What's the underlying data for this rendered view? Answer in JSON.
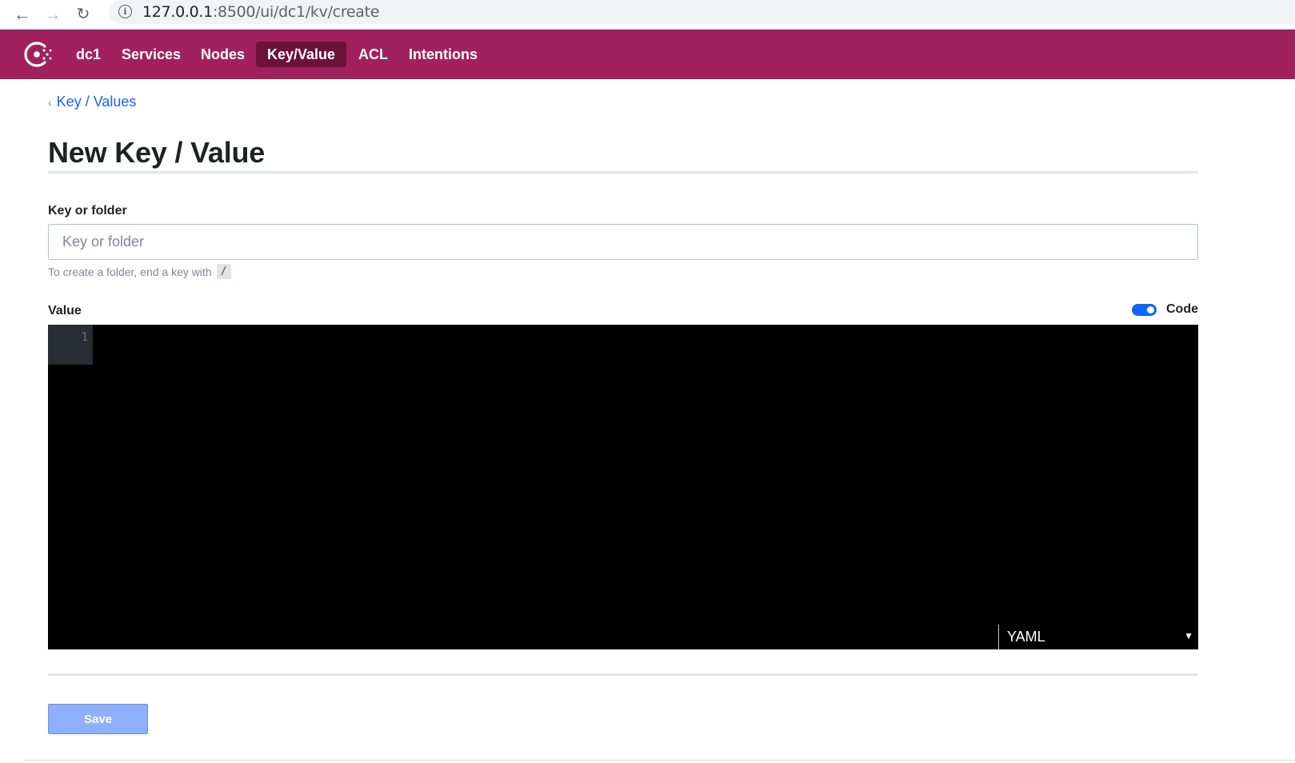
{
  "browser": {
    "back_icon": "arrow-left-icon",
    "forward_icon": "arrow-right-icon",
    "reload_icon": "reload-icon",
    "url_host": "127.0.0.1",
    "url_path": ":8500/ui/dc1/kv/create"
  },
  "nav": {
    "brand_color": "#a0215d",
    "active_color": "#6b1239",
    "datacenter": "dc1",
    "items": [
      "Services",
      "Nodes",
      "Key/Value",
      "ACL",
      "Intentions"
    ],
    "active": "Key/Value"
  },
  "breadcrumb": {
    "label": "Key / Values"
  },
  "page": {
    "title": "New Key / Value"
  },
  "form": {
    "key_label": "Key or folder",
    "key_placeholder": "Key or folder",
    "key_value": "",
    "help_text": "To create a folder, end a key with",
    "help_code": "/",
    "value_label": "Value",
    "code_toggle_label": "Code",
    "code_toggle_on": true,
    "editor": {
      "line_numbers": [
        "1"
      ],
      "mode": "YAML"
    },
    "save_label": "Save"
  }
}
